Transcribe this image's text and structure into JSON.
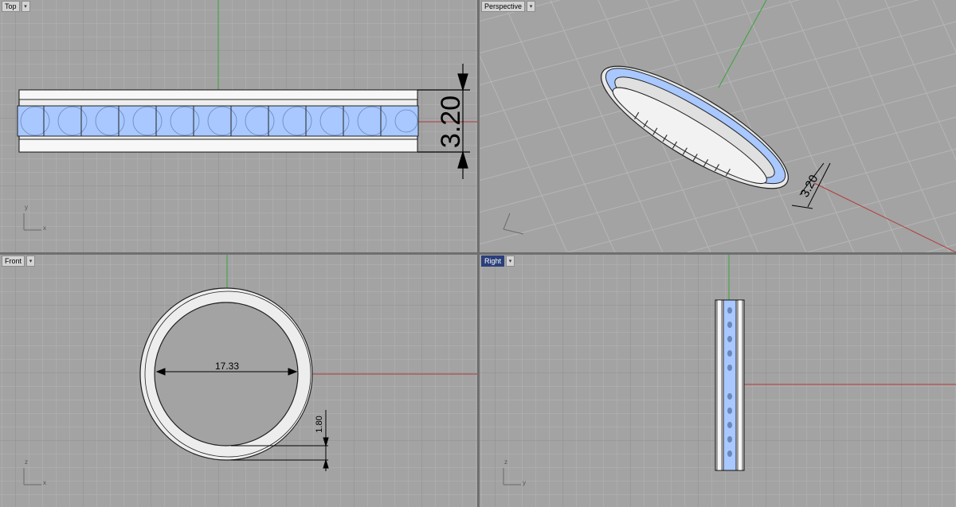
{
  "viewports": {
    "top": {
      "title": "Top",
      "dimension": "3.20",
      "axis_x": "x",
      "axis_y": "y"
    },
    "perspective": {
      "title": "Perspective",
      "dimension": "3.20"
    },
    "front": {
      "title": "Front",
      "diameter": "17.33",
      "thickness": "1.80",
      "axis_x": "x",
      "axis_z": "z"
    },
    "right": {
      "title": "Right",
      "axis_y": "y",
      "axis_z": "z"
    }
  },
  "icons": {
    "viewport_menu": "chevron-down-icon"
  },
  "colors": {
    "background": "#a3a3a3",
    "grid": "#b5b5b5",
    "x_axis": "#b23a3a",
    "y_axis": "#3aa33a",
    "stone": "#a8c8ff",
    "metal": "#f2f2f2",
    "active_title": "#2b3f7a"
  }
}
